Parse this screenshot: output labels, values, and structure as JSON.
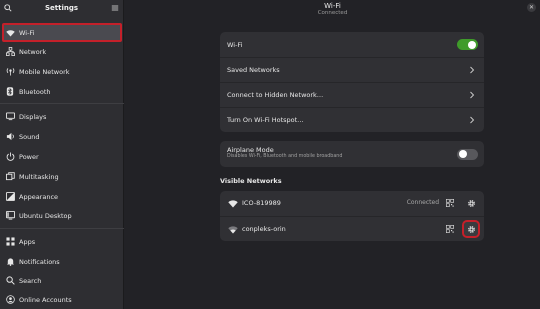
{
  "sidebar": {
    "title": "Settings",
    "items": [
      {
        "label": "Wi-Fi",
        "icon": "wifi-icon"
      },
      {
        "label": "Network",
        "icon": "network-icon"
      },
      {
        "label": "Mobile Network",
        "icon": "mobile-network-icon"
      },
      {
        "label": "Bluetooth",
        "icon": "bluetooth-icon"
      },
      {
        "label": "Displays",
        "icon": "display-icon"
      },
      {
        "label": "Sound",
        "icon": "speaker-icon"
      },
      {
        "label": "Power",
        "icon": "power-icon"
      },
      {
        "label": "Multitasking",
        "icon": "multitasking-icon"
      },
      {
        "label": "Appearance",
        "icon": "appearance-icon"
      },
      {
        "label": "Ubuntu Desktop",
        "icon": "ubuntu-desktop-icon"
      },
      {
        "label": "Apps",
        "icon": "apps-icon"
      },
      {
        "label": "Notifications",
        "icon": "bell-icon"
      },
      {
        "label": "Search",
        "icon": "search-icon"
      },
      {
        "label": "Online Accounts",
        "icon": "online-accounts-icon"
      }
    ]
  },
  "header": {
    "title": "Wi-Fi",
    "subtitle": "Connected"
  },
  "main": {
    "wifi_label": "Wi-Fi",
    "wifi_enabled": true,
    "rows": [
      {
        "label": "Saved Networks"
      },
      {
        "label": "Connect to Hidden Network…"
      },
      {
        "label": "Turn On Wi-Fi Hotspot…"
      }
    ],
    "airplane": {
      "title": "Airplane Mode",
      "subtitle": "Disables Wi-Fi, Bluetooth and mobile broadband",
      "enabled": false
    },
    "visible_networks": {
      "heading": "Visible Networks",
      "networks": [
        {
          "name": "ICO-819989",
          "status": "Connected"
        },
        {
          "name": "conpleks-orin",
          "status": ""
        }
      ]
    }
  },
  "colors": {
    "accent_green": "#3f9b2a",
    "highlight_red": "#c4202a"
  }
}
